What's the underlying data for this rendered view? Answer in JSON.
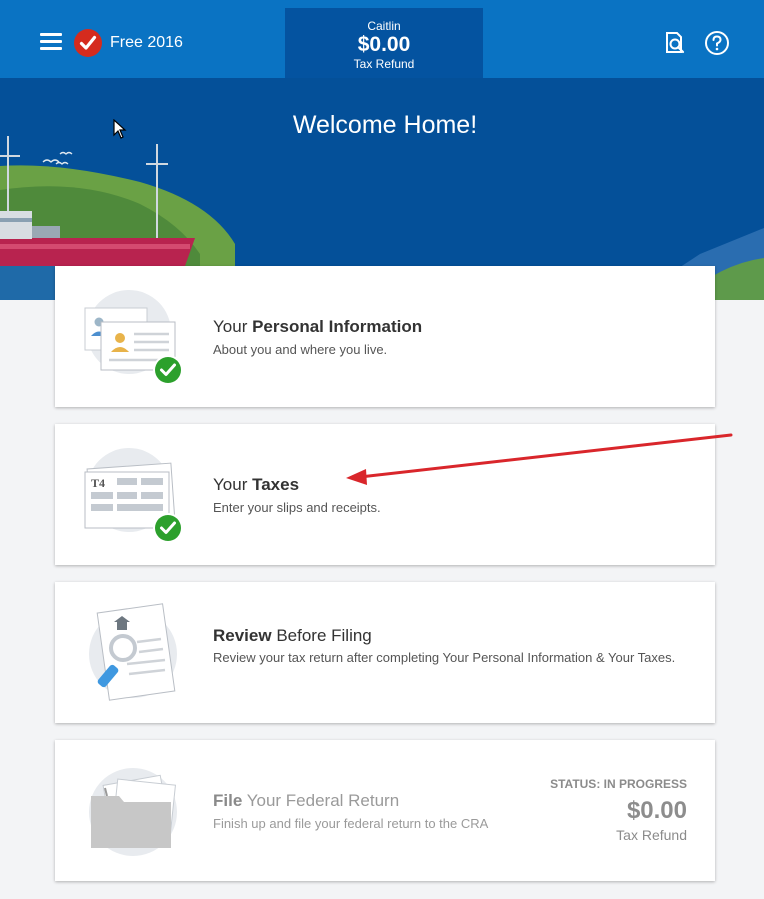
{
  "header": {
    "brand_label": "Free 2016",
    "user_name": "Caitlin",
    "refund_amount": "$0.00",
    "refund_label": "Tax Refund",
    "icons": [
      "menu-icon",
      "logo-check-icon",
      "search-document-icon",
      "help-icon"
    ]
  },
  "hero": {
    "title": "Welcome Home!"
  },
  "cards": [
    {
      "title_pre": "Your ",
      "title_bold": "Personal Information",
      "title_post": "",
      "subtitle": "About you and where you live.",
      "completed": true
    },
    {
      "title_pre": "Your ",
      "title_bold": "Taxes",
      "title_post": "",
      "subtitle": "Enter your slips and receipts.",
      "completed": true,
      "art_text": "T4"
    },
    {
      "title_pre": "",
      "title_bold": "Review",
      "title_post": " Before Filing",
      "subtitle": "Review your tax return after completing Your Personal Information & Your Taxes.",
      "completed": false
    },
    {
      "title_pre": "",
      "title_bold": "File",
      "title_post": " Your Federal Return",
      "subtitle": "Finish up and file your federal return to the CRA",
      "completed": false,
      "status_text": "STATUS:  IN PROGRESS",
      "status_amount": "$0.00",
      "status_label": "Tax Refund"
    }
  ],
  "colors": {
    "header_blue": "#0a73c3",
    "hero_blue": "#045099",
    "check_green": "#2ca02c",
    "brand_red": "#d52b1e",
    "annotation_arrow": "#d9262b"
  }
}
